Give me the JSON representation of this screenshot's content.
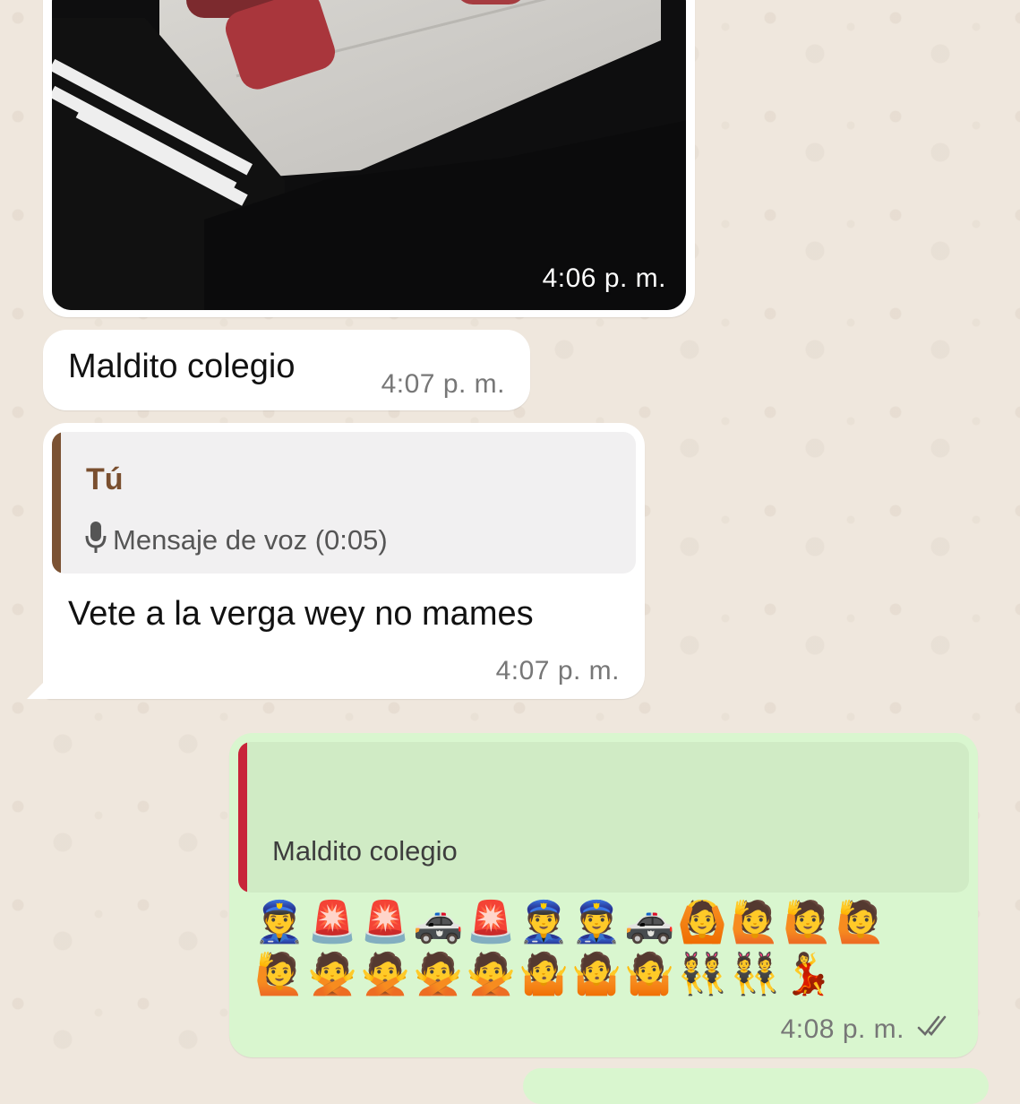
{
  "messages": {
    "photo": {
      "time": "4:06 p. m."
    },
    "maldito": {
      "text": "Maldito colegio",
      "time": "4:07 p. m."
    },
    "reply": {
      "quote_author": "Tú",
      "quote_icon": "microphone-icon",
      "quote_text": "Mensaje de voz (0:05)",
      "text": "Vete a la verga wey no mames",
      "time": "4:07 p. m.",
      "quote_bar_color": "#7b5233"
    },
    "outgoing": {
      "quote_text": "Maldito colegio",
      "quote_bar_color": "#c8243a",
      "emoji_line_1": "👮🚨🚨🚓🚨👮👮🚓🙆🙋🙋🙋",
      "emoji_line_2": "🙋🙅🙅🙅🙅🤷🤷🤷👯👯💃",
      "time": "4:08 p. m.",
      "status_icon": "double-check-icon"
    }
  },
  "colors": {
    "wallpaper": "#efe7dd",
    "incoming_bubble": "#ffffff",
    "outgoing_bubble": "#d9f6cf",
    "timestamp": "#777777"
  }
}
